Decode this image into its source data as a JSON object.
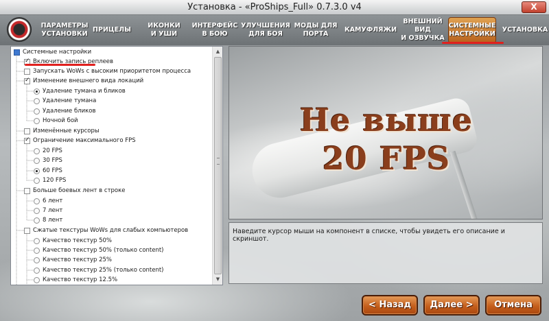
{
  "window": {
    "title": "Установка - «ProShips_Full» 0.7.3.0 v4",
    "close_label": "X"
  },
  "nav": {
    "items": [
      {
        "label": "ПАРАМЕТРЫ\nУСТАНОВКИ",
        "active": false
      },
      {
        "label": "ПРИЦЕЛЫ",
        "active": false
      },
      {
        "label": "ИКОНКИ\nИ УШИ",
        "active": false
      },
      {
        "label": "ИНТЕРФЕЙС\nВ БОЮ",
        "active": false
      },
      {
        "label": "УЛУЧШЕНИЯ\nДЛЯ БОЯ",
        "active": false
      },
      {
        "label": "МОДЫ ДЛЯ\nПОРТА",
        "active": false
      },
      {
        "label": "КАМУФЛЯЖИ",
        "active": false
      },
      {
        "label": "ВНЕШНИЙ ВИД\nИ ОЗВУЧКА",
        "active": false
      },
      {
        "label": "СИСТЕМНЫЕ\nНАСТРОЙКИ",
        "active": true
      },
      {
        "label": "УСТАНОВКА",
        "active": false
      }
    ]
  },
  "tree": {
    "root_label": "Системные настройки",
    "items": [
      {
        "label": "Включить запись реплеев",
        "kind": "checkbox",
        "checked": true
      },
      {
        "label": "Запускать WoWs с высоким приоритетом процесса",
        "kind": "checkbox",
        "checked": false
      },
      {
        "label": "Изменение внешнего вида локаций",
        "kind": "checkbox",
        "checked": true
      },
      {
        "label": "Удаление тумана и бликов",
        "kind": "radio",
        "checked": true
      },
      {
        "label": "Удаление тумана",
        "kind": "radio",
        "checked": false
      },
      {
        "label": "Удаление бликов",
        "kind": "radio",
        "checked": false
      },
      {
        "label": "Ночной бой",
        "kind": "radio",
        "checked": false
      },
      {
        "label": "Изменённые курсоры",
        "kind": "checkbox",
        "checked": false
      },
      {
        "label": "Ограничение максимального FPS",
        "kind": "checkbox",
        "checked": true
      },
      {
        "label": "20 FPS",
        "kind": "radio",
        "checked": false
      },
      {
        "label": "30 FPS",
        "kind": "radio",
        "checked": false
      },
      {
        "label": "60 FPS",
        "kind": "radio",
        "checked": true
      },
      {
        "label": "120 FPS",
        "kind": "radio",
        "checked": false
      },
      {
        "label": "Больше боевых лент в строке",
        "kind": "checkbox",
        "checked": false
      },
      {
        "label": "6 лент",
        "kind": "radio",
        "checked": false
      },
      {
        "label": "7 лент",
        "kind": "radio",
        "checked": false
      },
      {
        "label": "8 лент",
        "kind": "radio",
        "checked": false
      },
      {
        "label": "Сжатые текстуры WoWs для слабых компьютеров",
        "kind": "checkbox",
        "checked": false
      },
      {
        "label": "Качество текстур 50%",
        "kind": "radio",
        "checked": false
      },
      {
        "label": "Качество текстур 50% (только content)",
        "kind": "radio",
        "checked": false
      },
      {
        "label": "Качество текстур 25%",
        "kind": "radio",
        "checked": false
      },
      {
        "label": "Качество текстур 25% (только content)",
        "kind": "radio",
        "checked": false
      },
      {
        "label": "Качество текстур 12.5%",
        "kind": "radio",
        "checked": false
      }
    ]
  },
  "preview": {
    "line1": "Не выше",
    "line2": "20 FPS"
  },
  "description": "Наведите курсор мыши на компонент в списке, чтобы увидеть его описание и скриншот.",
  "buttons": {
    "back": "< Назад",
    "next": "Далее >",
    "cancel": "Отмена"
  },
  "colors": {
    "accent_orange": "#c55f1c",
    "highlight_red": "#e0201e",
    "preview_text": "#8a3e1c"
  }
}
